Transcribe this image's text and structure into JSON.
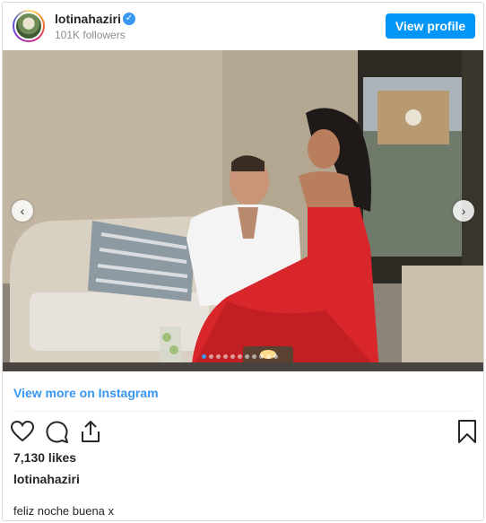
{
  "header": {
    "username": "lotinahaziri",
    "verified_mark": "✓",
    "followers": "101K followers",
    "view_profile_label": "View profile"
  },
  "photo": {
    "prev_arrow": "‹",
    "next_arrow": "›",
    "carousel_dots": 11,
    "active_dot_index": 0
  },
  "links": {
    "view_more": "View more on Instagram"
  },
  "actions": {
    "icons": [
      "heart-icon",
      "comment-icon",
      "share-icon",
      "bookmark-icon"
    ]
  },
  "post": {
    "likes": "7,130 likes",
    "caption_username": "lotinahaziri",
    "caption_text": "feliz noche buena x"
  },
  "colors": {
    "accent": "#0095f6",
    "link": "#3897f0",
    "dress": "#d8262a"
  }
}
